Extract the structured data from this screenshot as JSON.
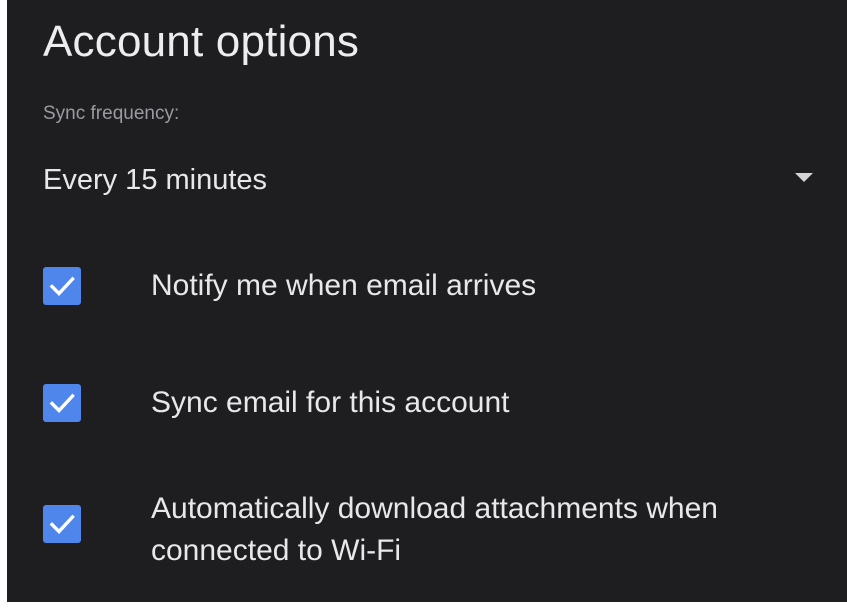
{
  "page": {
    "title": "Account options"
  },
  "sync": {
    "label": "Sync frequency:",
    "selected": "Every 15 minutes"
  },
  "options": [
    {
      "label": "Notify me when email arrives",
      "checked": true
    },
    {
      "label": "Sync email for this account",
      "checked": true
    },
    {
      "label": "Automatically download attachments when connected to Wi-Fi",
      "checked": true
    }
  ],
  "colors": {
    "background": "#1e1e20",
    "accent": "#4f86ec",
    "text": "#e8e8ea",
    "secondary_text": "#9a9aa0"
  },
  "icons": {
    "dropdown": "dropdown-arrow-icon",
    "check": "checkmark-icon"
  }
}
